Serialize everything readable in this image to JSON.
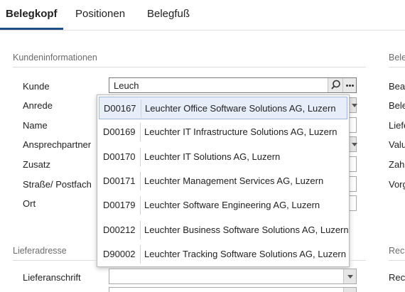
{
  "tabs": [
    {
      "label": "Belegkopf",
      "active": true
    },
    {
      "label": "Positionen",
      "active": false
    },
    {
      "label": "Belegfuß",
      "active": false
    }
  ],
  "sections": {
    "kunde": "Kundeninformationen",
    "beleg": "Belegi",
    "liefer": "Lieferadresse",
    "rechnung": "Rechnu"
  },
  "labels": {
    "kunde": "Kunde",
    "anrede": "Anrede",
    "name": "Name",
    "ansprechpartner": "Ansprechpartner",
    "zusatz": "Zusatz",
    "strasse": "Straße/ Postfach",
    "ort": "Ort",
    "lieferanschrift": "Lieferanschrift"
  },
  "right_labels": [
    "Bea",
    "Bele",
    "Liefe",
    "Valu",
    "Zahl",
    "Vorg",
    "Rech"
  ],
  "search": {
    "value": "Leuch"
  },
  "dropdown_options": [
    {
      "code": "D00167",
      "name": "Leuchter Office Software Solutions AG, Luzern",
      "selected": true
    },
    {
      "code": "D00169",
      "name": "Leuchter IT Infrastructure Solutions AG, Luzern",
      "selected": false
    },
    {
      "code": "D00170",
      "name": "Leuchter IT Solutions AG, Luzern",
      "selected": false
    },
    {
      "code": "D00171",
      "name": "Leuchter Management Services AG, Luzern",
      "selected": false
    },
    {
      "code": "D00179",
      "name": "Leuchter Software Engineering AG, Luzern",
      "selected": false
    },
    {
      "code": "D00212",
      "name": "Leuchter Business Software Solutions AG, Luzern",
      "selected": false
    },
    {
      "code": "D90002",
      "name": "Leuchter Tracking Software Solutions AG, Luzern",
      "selected": false
    }
  ],
  "icons": {
    "search": "search-icon",
    "more": "more-options-icon",
    "dropdown": "chevron-down-icon"
  },
  "colors": {
    "accent": "#1f4e86",
    "selection": "#e7eefa"
  }
}
